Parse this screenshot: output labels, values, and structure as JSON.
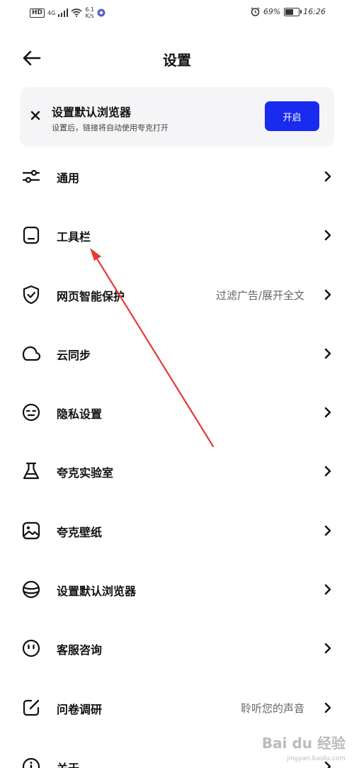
{
  "status_bar": {
    "hd": "HD",
    "network": "4G",
    "speed_value": "6.1",
    "speed_unit": "K/s",
    "battery_percent": "69%",
    "battery_level": 0.69,
    "time": "16:26"
  },
  "header": {
    "title": "设置"
  },
  "banner": {
    "title": "设置默认浏览器",
    "subtitle": "设置后，链接将自动使用夸克打开",
    "button_label": "开启",
    "button_color": "#1a2bf0"
  },
  "items": [
    {
      "label": "通用",
      "value": "",
      "icon": "sliders-icon"
    },
    {
      "label": "工具栏",
      "value": "",
      "icon": "toolbar-icon"
    },
    {
      "label": "网页智能保护",
      "value": "过滤广告/展开全文",
      "icon": "shield-check-icon"
    },
    {
      "label": "云同步",
      "value": "",
      "icon": "cloud-icon"
    },
    {
      "label": "隐私设置",
      "value": "",
      "icon": "privacy-face-icon"
    },
    {
      "label": "夸克实验室",
      "value": "",
      "icon": "flask-icon"
    },
    {
      "label": "夸克壁纸",
      "value": "",
      "icon": "wallpaper-icon"
    },
    {
      "label": "设置默认浏览器",
      "value": "",
      "icon": "browser-default-icon"
    },
    {
      "label": "客服咨询",
      "value": "",
      "icon": "smile-face-icon"
    },
    {
      "label": "问卷调研",
      "value": "聆听您的声音",
      "icon": "edit-icon"
    },
    {
      "label": "关于",
      "value": "",
      "icon": "info-icon"
    }
  ],
  "watermark": {
    "text": "Bai du 经验",
    "url": "jingyan.baidu.com"
  },
  "colors": {
    "annotation_arrow": "#e53935",
    "banner_bg": "#f5f5f7"
  }
}
